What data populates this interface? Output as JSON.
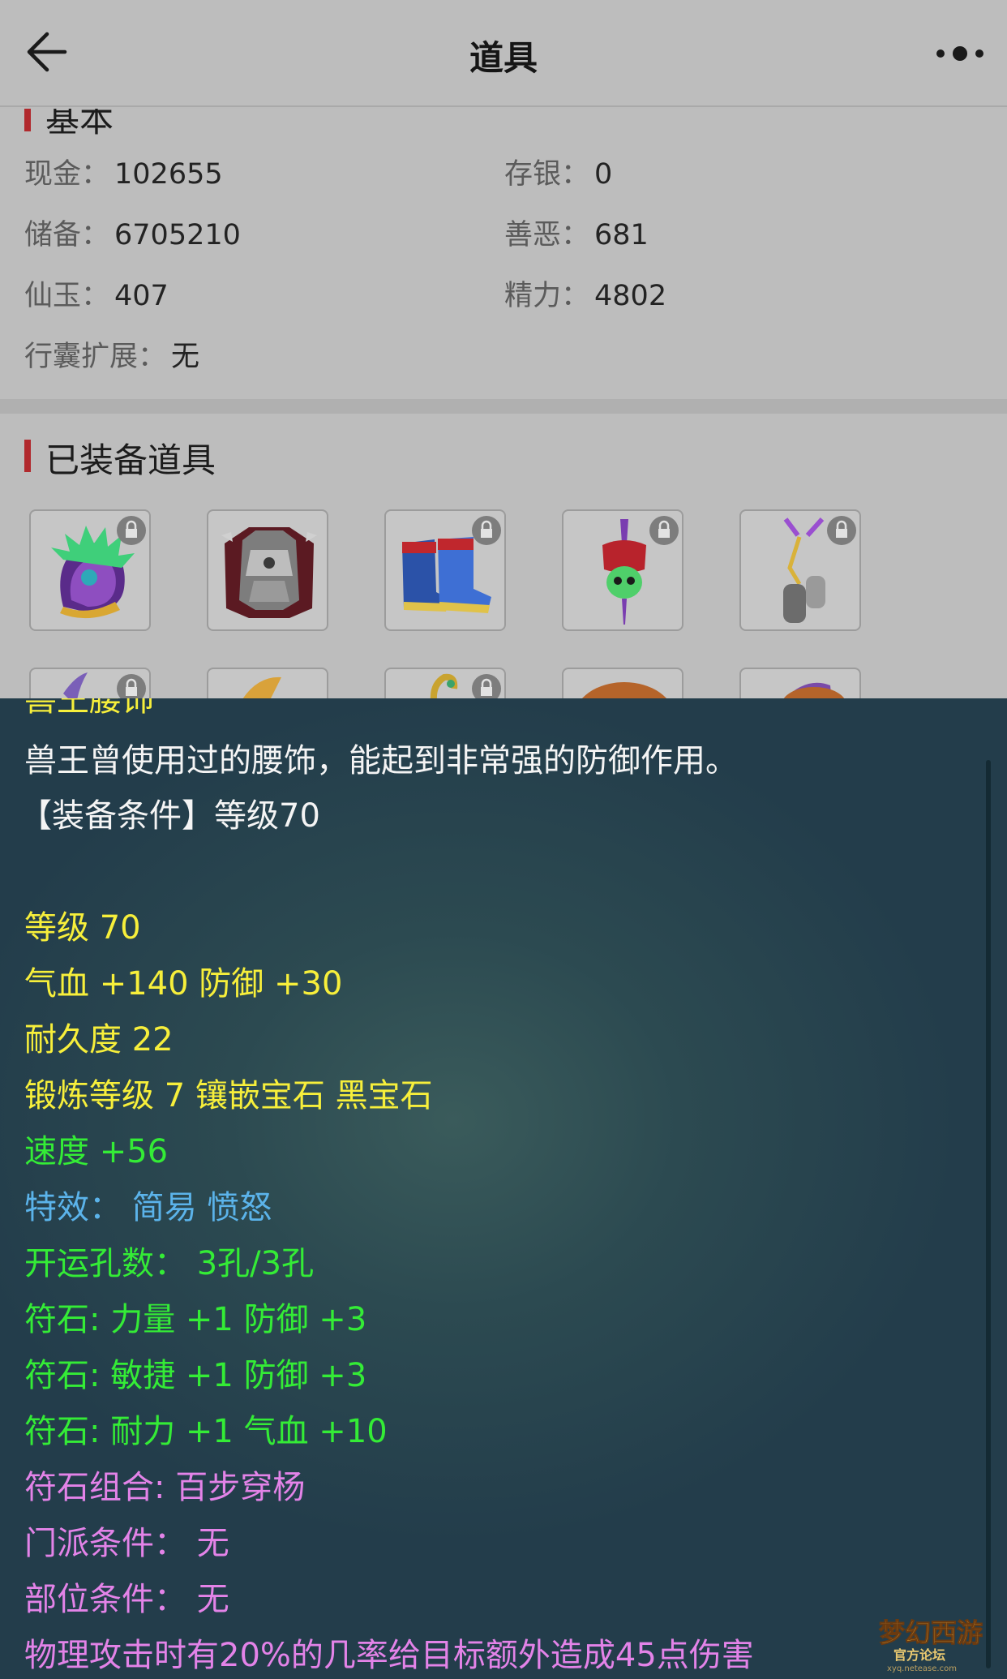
{
  "header": {
    "title": "道具",
    "back_icon": "arrow-left-icon",
    "more_icon": "more-dots-icon"
  },
  "basic": {
    "title": "基本",
    "fields": [
      {
        "label": "现金：",
        "value": "102655"
      },
      {
        "label": "存银：",
        "value": "0"
      },
      {
        "label": "储备：",
        "value": "6705210"
      },
      {
        "label": "善恶：",
        "value": "681"
      },
      {
        "label": "仙玉：",
        "value": "407"
      },
      {
        "label": "精力：",
        "value": "4802"
      },
      {
        "label": "行囊扩展：",
        "value": "无"
      }
    ]
  },
  "equipped": {
    "title": "已装备道具",
    "items": [
      {
        "name": "helmet-item"
      },
      {
        "name": "armor-item"
      },
      {
        "name": "boots-item"
      },
      {
        "name": "necklace-item"
      },
      {
        "name": "belt-item"
      },
      {
        "name": "weapon-item"
      },
      {
        "name": "leaf-item"
      },
      {
        "name": "serpent-item"
      },
      {
        "name": "hat-item"
      },
      {
        "name": "bundle-item"
      }
    ]
  },
  "tooltip": {
    "item_name_partial": "兽王腰饰",
    "description": "兽王曾使用过的腰饰，能起到非常强的防御作用。",
    "requirement": "【装备条件】等级70",
    "level": "等级 70",
    "hp_def": "气血 +140 防御 +30",
    "durability": "耐久度 22",
    "forge": "锻炼等级 7 镶嵌宝石 黑宝石",
    "speed": "速度 +56",
    "special": "特效：  简易 愤怒",
    "fortune_holes": "开运孔数：  3孔/3孔",
    "rune1": "符石: 力量 +1 防御 +3",
    "rune2": "符石: 敏捷 +1 防御 +3",
    "rune3": "符石: 耐力 +1 气血 +10",
    "rune_combo": "符石组合: 百步穿杨",
    "school_req": "门派条件：  无",
    "slot_req": "部位条件：  无",
    "effect": "物理攻击时有20%的几率给目标额外造成45点伤害"
  },
  "watermark": {
    "text": "梦幻西游",
    "sub": "官方论坛",
    "url": "xyq.netease.com"
  },
  "colors": {
    "accent_bar": "#b1292d",
    "tooltip_bg": "#2c4a51",
    "white_text": "#f4f4f4",
    "yellow_text": "#f7ef3b",
    "green_text": "#34ec36",
    "blue_text": "#5bb3ea",
    "pink_text": "#e383e8"
  }
}
